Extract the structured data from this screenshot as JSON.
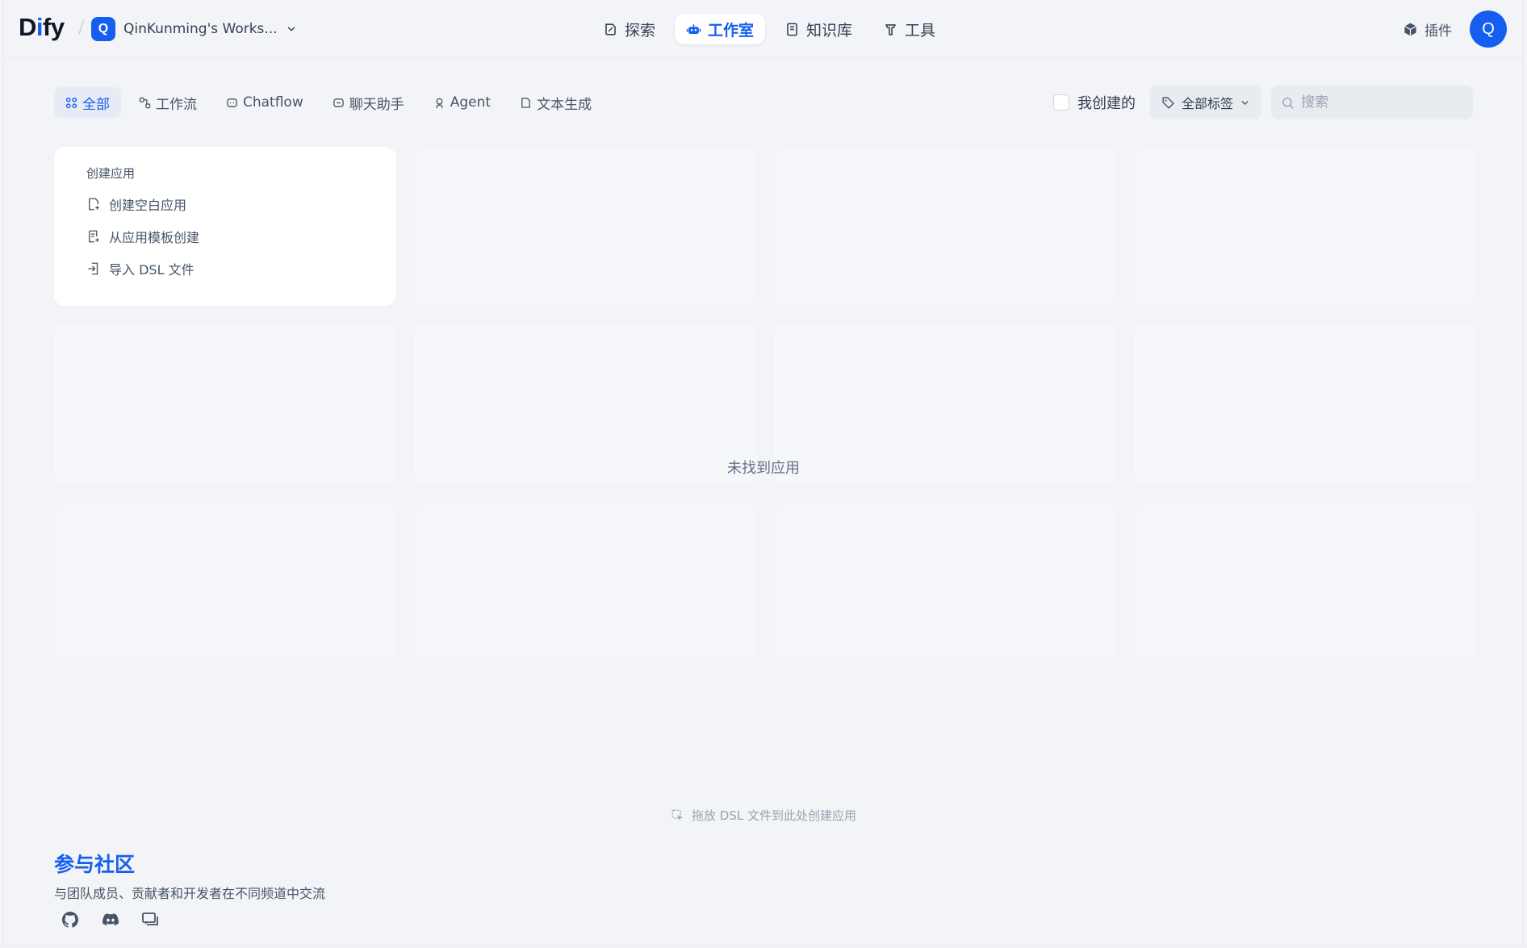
{
  "brand": {
    "logo_text": "Dify",
    "accent": "#155eef"
  },
  "workspace": {
    "avatar_letter": "Q",
    "name": "QinKunming's Works..."
  },
  "nav": [
    {
      "label": "探索",
      "icon": "explore-icon"
    },
    {
      "label": "工作室",
      "icon": "robot-icon",
      "active": true
    },
    {
      "label": "知识库",
      "icon": "book-icon"
    },
    {
      "label": "工具",
      "icon": "tool-icon"
    }
  ],
  "header_right": {
    "plugins_label": "插件",
    "user_avatar_letter": "Q"
  },
  "filter_tabs": [
    {
      "label": "全部",
      "active": true
    },
    {
      "label": "工作流"
    },
    {
      "label": "Chatflow"
    },
    {
      "label": "聊天助手"
    },
    {
      "label": "Agent"
    },
    {
      "label": "文本生成"
    }
  ],
  "filters": {
    "created_by_me_label": "我创建的",
    "tags_label": "全部标签",
    "search_placeholder": "搜索"
  },
  "create_card": {
    "title": "创建应用",
    "items": [
      "创建空白应用",
      "从应用模板创建",
      "导入 DSL 文件"
    ]
  },
  "empty_text": "未找到应用",
  "drop_hint": "拖放 DSL 文件到此处创建应用",
  "community": {
    "title": "参与社区",
    "subtitle": "与团队成员、贡献者和开发者在不同频道中交流"
  },
  "social": [
    "github-icon",
    "discord-icon",
    "forum-icon"
  ]
}
